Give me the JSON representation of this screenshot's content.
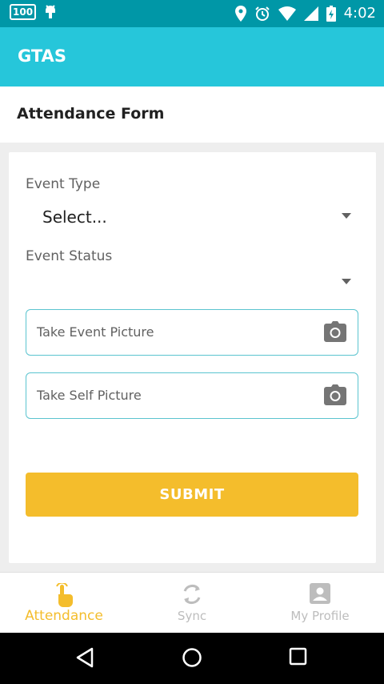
{
  "status_bar": {
    "badge": "100",
    "time": "4:02"
  },
  "app_bar": {
    "title": "GTAS"
  },
  "form": {
    "title": "Attendance Form",
    "event_type": {
      "label": "Event Type",
      "value": "Select..."
    },
    "event_status": {
      "label": "Event Status",
      "value": ""
    },
    "event_picture": {
      "label": "Take Event Picture"
    },
    "self_picture": {
      "label": "Take Self Picture"
    },
    "submit_label": "SUBMIT"
  },
  "bottom_nav": {
    "items": [
      {
        "label": "Attendance",
        "active": true
      },
      {
        "label": "Sync",
        "active": false
      },
      {
        "label": "My Profile",
        "active": false
      }
    ]
  },
  "colors": {
    "app_bar": "#26c6da",
    "status_bar": "#0097a7",
    "accent": "#f4bd2c",
    "field_border": "#5bc4cf"
  }
}
